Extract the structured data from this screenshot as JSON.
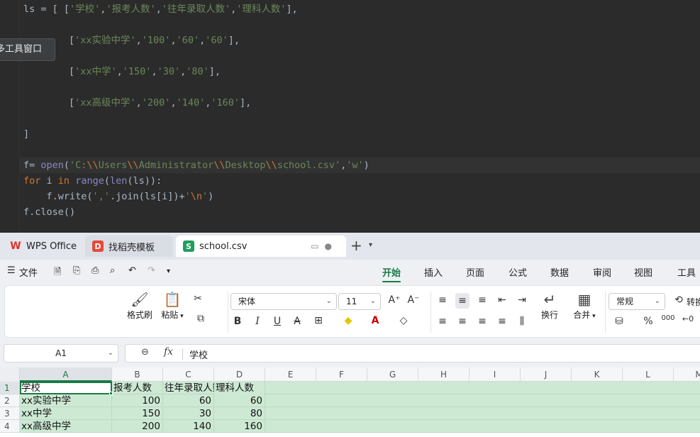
{
  "editor": {
    "lines": [
      "ls = [ ['学校','报考人数','往年录取人数','理科人数'],",
      "['xx实验中学','100','60','60'],",
      "['xx中学','150','30','80'],",
      "['xx高级中学','200','140','160'],",
      "]",
      "f= open('C:\\\\Users\\\\Administrator\\\\Desktop\\\\school.csv','w')",
      "for i in range(len(ls)):",
      "    f.write(','.join(ls[i])+'\\n')",
      "f.close()"
    ],
    "tooltip": "多工具窗口"
  },
  "wps": {
    "tabs": [
      {
        "label": "WPS Office",
        "icon": "wps-logo-icon"
      },
      {
        "label": "找稻壳模板",
        "icon": "docer-icon"
      },
      {
        "label": "school.csv",
        "icon": "spreadsheet-s-icon"
      }
    ],
    "menu": {
      "file_label": "文件",
      "tabs": [
        "开始",
        "插入",
        "页面",
        "公式",
        "数据",
        "审阅",
        "视图",
        "工具"
      ],
      "active_tab": "开始"
    },
    "ribbon": {
      "format_painter": "格式刷",
      "paste": "粘贴",
      "font_name": "宋体",
      "font_size": "11",
      "wrap": "换行",
      "merge": "合并",
      "number_format": "常规",
      "convert": "转换",
      "bold": "B",
      "italic": "I",
      "underline": "U",
      "strike": "A",
      "font_grow": "A⁺",
      "font_shrink": "A⁻",
      "percent": "%",
      "thousands": "000"
    },
    "formula_bar": {
      "name_box": "A1",
      "fx": "fx",
      "value": "学校"
    },
    "sheet": {
      "columns": [
        "A",
        "B",
        "C",
        "D",
        "E",
        "F",
        "G",
        "H",
        "I",
        "J",
        "K",
        "L",
        "M"
      ],
      "rows": [
        {
          "num": "1",
          "cells": [
            "学校",
            "报考人数",
            "往年录取人数",
            "理科人数"
          ]
        },
        {
          "num": "2",
          "cells": [
            "xx实验中学",
            "100",
            "60",
            "60"
          ]
        },
        {
          "num": "3",
          "cells": [
            "xx中学",
            "150",
            "30",
            "80"
          ]
        },
        {
          "num": "4",
          "cells": [
            "xx高级中学",
            "200",
            "140",
            "160"
          ]
        }
      ],
      "selected_cell": "A1"
    }
  }
}
